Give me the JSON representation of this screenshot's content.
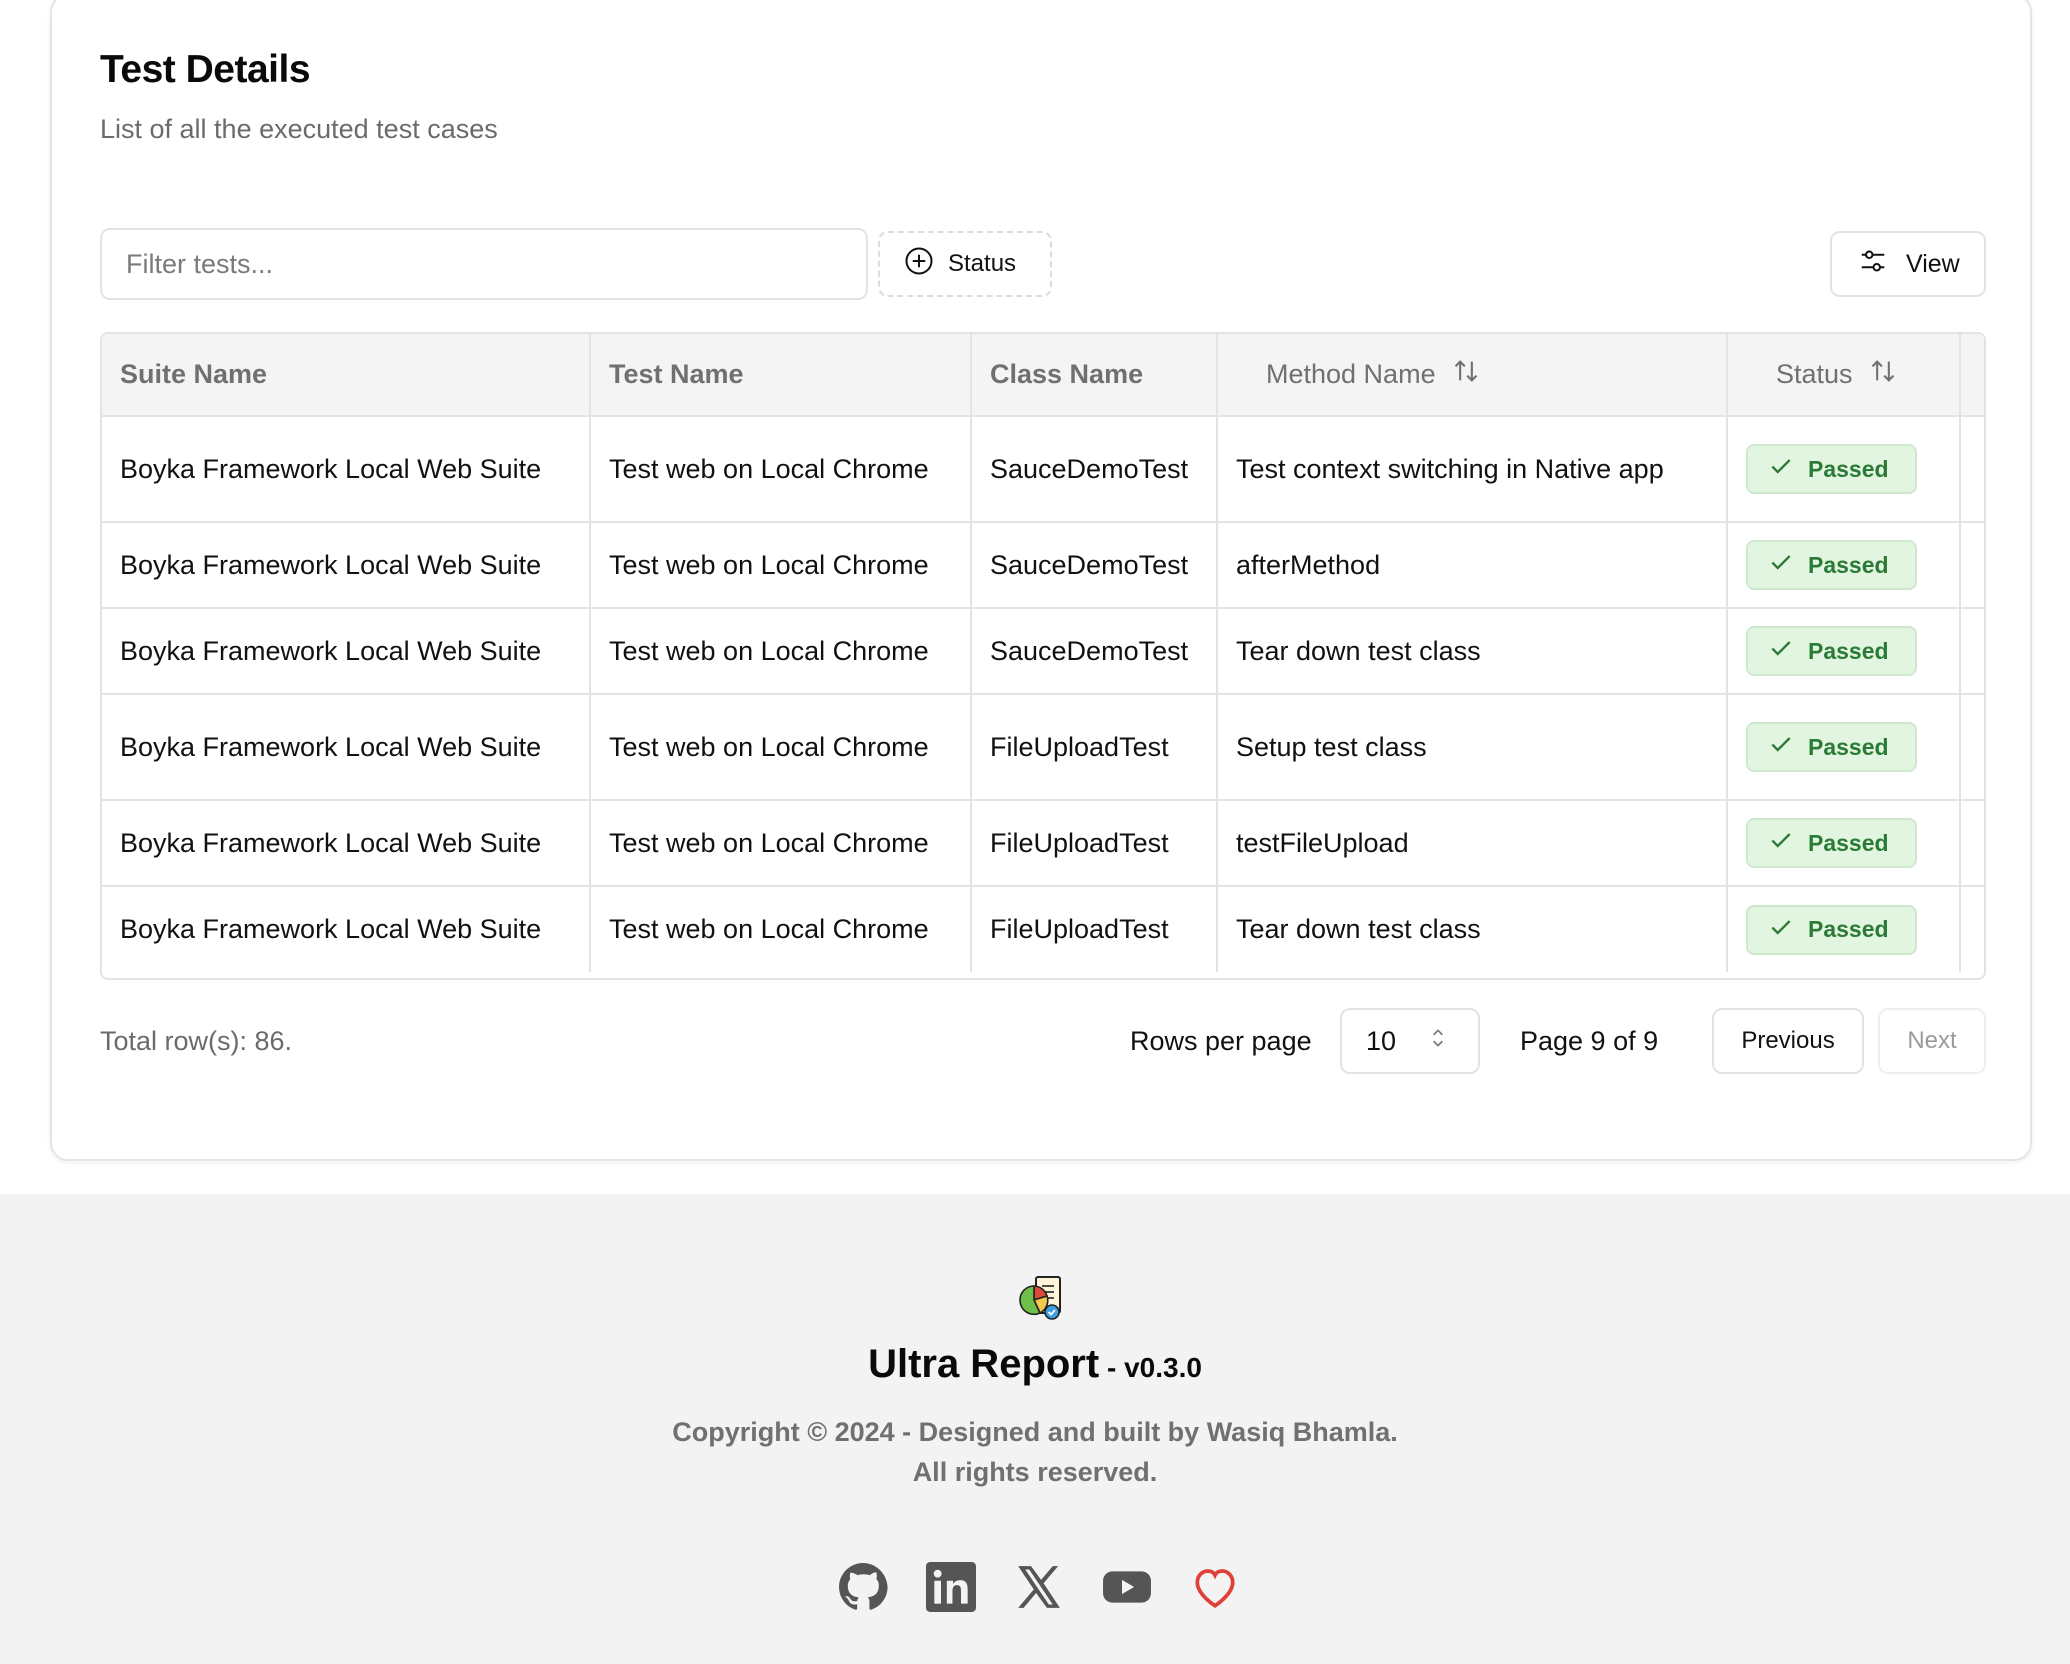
{
  "card": {
    "title": "Test Details",
    "subtitle": "List of all the executed test cases"
  },
  "toolbar": {
    "filter_placeholder": "Filter tests...",
    "status_filter_label": "Status",
    "view_label": "View"
  },
  "table": {
    "columns": [
      "Suite Name",
      "Test Name",
      "Class Name",
      "Method Name",
      "Status"
    ],
    "rows": [
      {
        "suite": "Boyka Framework Local Web Suite",
        "test": "Test web on Local Chrome",
        "class": "SauceDemoTest",
        "method": "Test context switching in Native app",
        "status": "Passed"
      },
      {
        "suite": "Boyka Framework Local Web Suite",
        "test": "Test web on Local Chrome",
        "class": "SauceDemoTest",
        "method": "afterMethod",
        "status": "Passed"
      },
      {
        "suite": "Boyka Framework Local Web Suite",
        "test": "Test web on Local Chrome",
        "class": "SauceDemoTest",
        "method": "Tear down test class",
        "status": "Passed"
      },
      {
        "suite": "Boyka Framework Local Web Suite",
        "test": "Test web on Local Chrome",
        "class": "FileUploadTest",
        "method": "Setup test class",
        "status": "Passed"
      },
      {
        "suite": "Boyka Framework Local Web Suite",
        "test": "Test web on Local Chrome",
        "class": "FileUploadTest",
        "method": "testFileUpload",
        "status": "Passed"
      },
      {
        "suite": "Boyka Framework Local Web Suite",
        "test": "Test web on Local Chrome",
        "class": "FileUploadTest",
        "method": "Tear down test class",
        "status": "Passed"
      }
    ]
  },
  "pagination": {
    "total": "Total row(s): 86.",
    "rows_per_page_label": "Rows per page",
    "rows_per_page_value": "10",
    "page_info": "Page 9 of 9",
    "previous_label": "Previous",
    "next_label": "Next"
  },
  "footer": {
    "app_name": "Ultra Report",
    "version": " - v0.3.0",
    "copyright": "Copyright © 2024 - Designed and built by Wasiq Bhamla.",
    "rights": "All rights reserved.",
    "social_icons": [
      "github-icon",
      "linkedin-icon",
      "x-icon",
      "youtube-icon",
      "heart-icon"
    ]
  },
  "colors": {
    "passed_bg": "#e2f5e1",
    "passed_text": "#2b7a36",
    "heart": "#e0403a",
    "footer_bg": "#f3f3f3"
  }
}
